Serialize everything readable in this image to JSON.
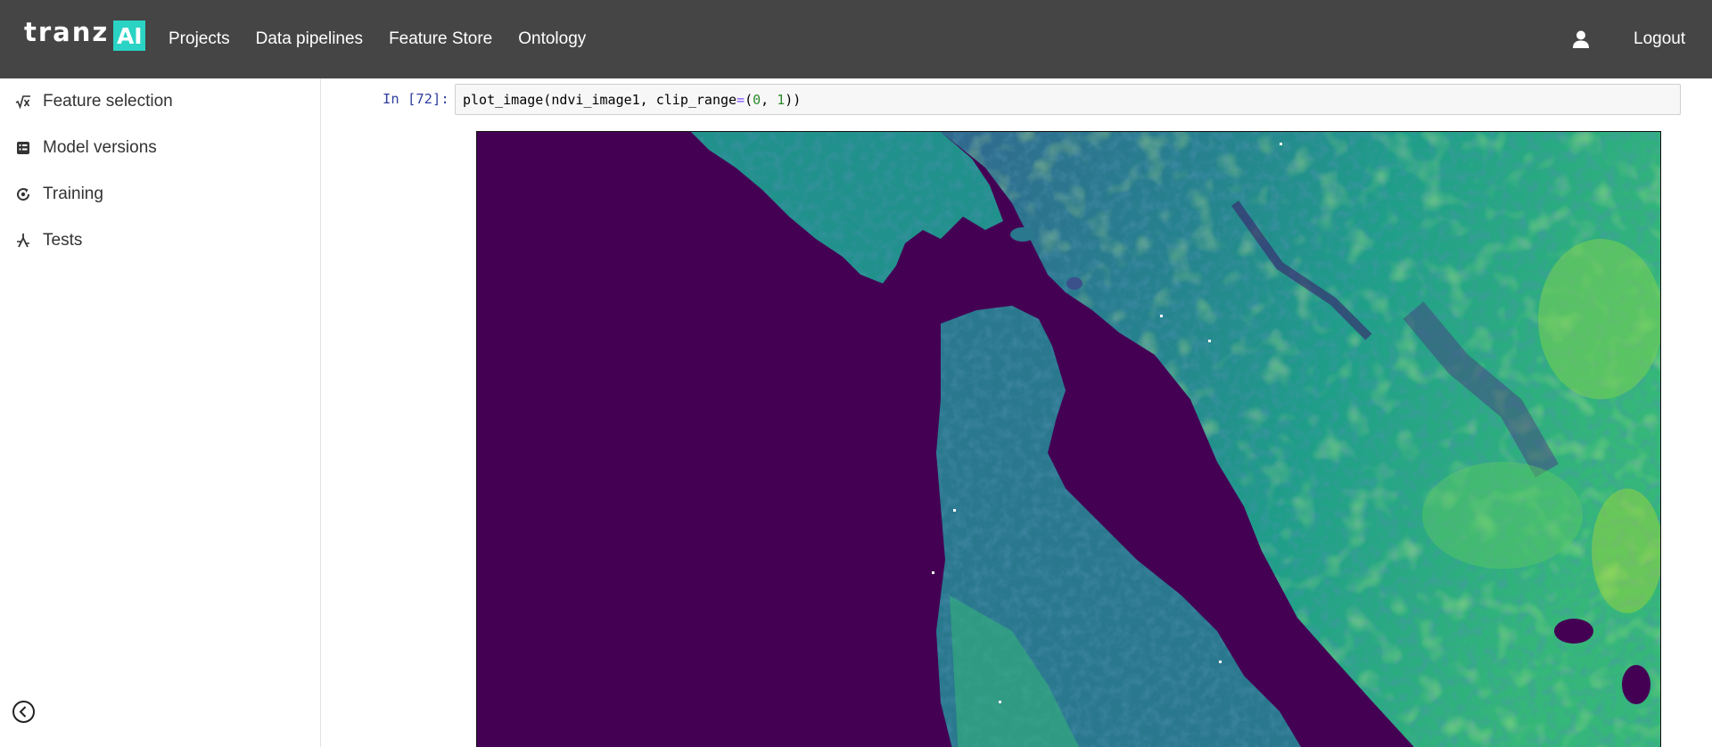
{
  "header": {
    "logo_text": "tranz",
    "logo_badge": "AI",
    "nav": [
      "Projects",
      "Data pipelines",
      "Feature Store",
      "Ontology"
    ],
    "logout_label": "Logout"
  },
  "sidebar": {
    "items": [
      {
        "label": "Feature selection",
        "icon": "sqrt-x-icon"
      },
      {
        "label": "Model versions",
        "icon": "list-icon"
      },
      {
        "label": "Training",
        "icon": "refresh-icon"
      },
      {
        "label": "Tests",
        "icon": "flask-icon"
      }
    ],
    "collapse_icon": "chevron-left-circle-icon"
  },
  "notebook": {
    "prompt": "In [72]:",
    "code_parts": {
      "fn": "plot_image(ndvi_image1, clip_range",
      "eq": "=",
      "open": "(",
      "n0": "0",
      "sep": ", ",
      "n1": "1",
      "close": "))"
    },
    "output_kind": "NDVI satellite image (viridis colormap)"
  },
  "colors": {
    "topbar": "#454545",
    "accent": "#2ad3c4",
    "prompt": "#303f9f",
    "water": "#440154",
    "veg_low": "#3b518b",
    "veg_mid": "#21918c",
    "veg_high": "#5ec962",
    "veg_peak": "#b5de2b"
  }
}
